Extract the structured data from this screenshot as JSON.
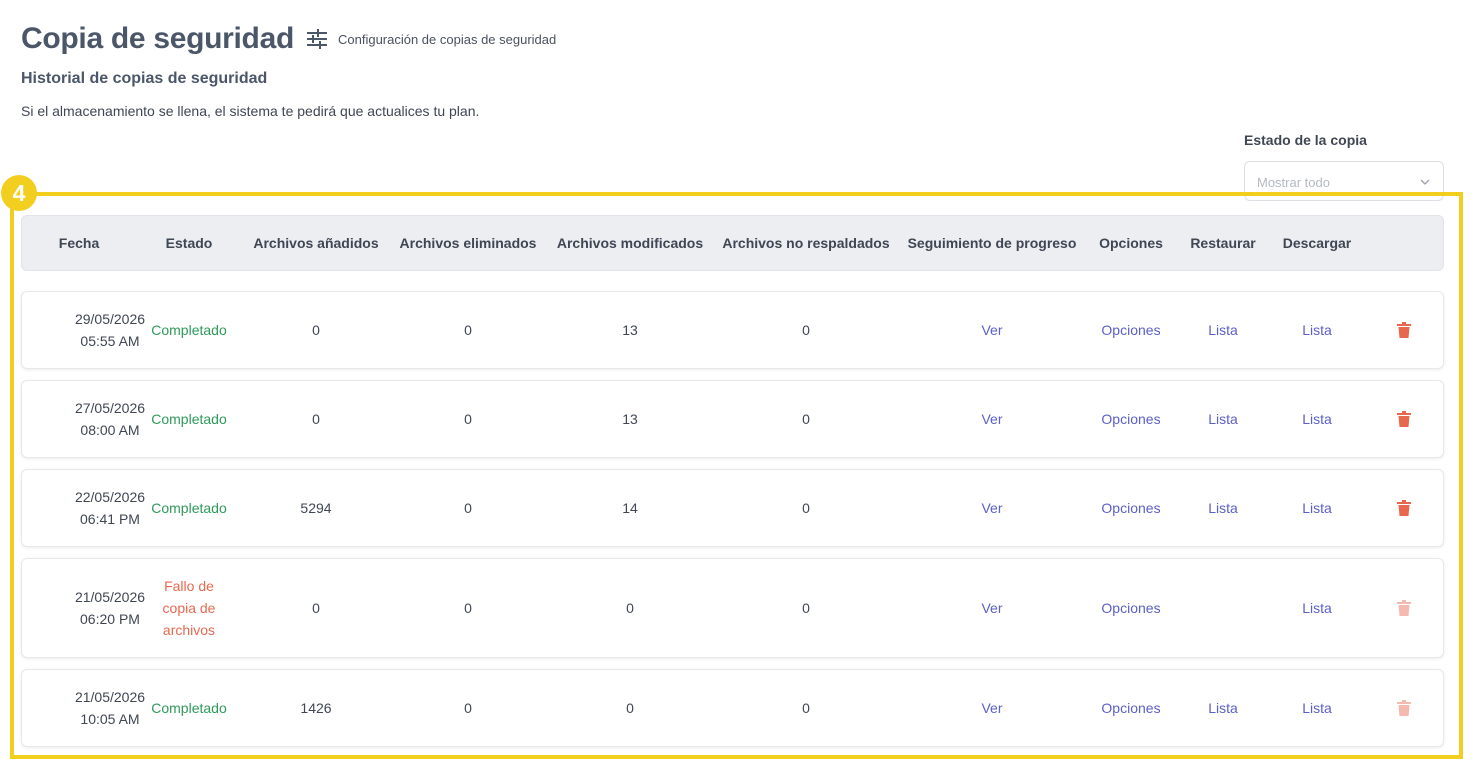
{
  "header": {
    "title": "Copia de seguridad",
    "settings_link": "Configuración de copias de seguridad"
  },
  "history": {
    "title": "Historial de copias de seguridad",
    "description": "Si el almacenamiento se llena, el sistema te pedirá que actualices tu plan."
  },
  "filter": {
    "label": "Estado de la copia",
    "placeholder": "Mostrar todo"
  },
  "annotation": {
    "badge": "4",
    "color": "#f2cf1f"
  },
  "colors": {
    "success": "#2e9a5a",
    "failure": "#e8684f",
    "link": "#5b5fc7",
    "delete": "#e8684f"
  },
  "table": {
    "columns": {
      "fecha": "Fecha",
      "estado": "Estado",
      "anadidos": "Archivos añadidos",
      "eliminados": "Archivos eliminados",
      "modificados": "Archivos modificados",
      "no_respaldados": "Archivos no respaldados",
      "seguimiento": "Seguimiento de progreso",
      "opciones": "Opciones",
      "restaurar": "Restaurar",
      "descargar": "Descargar"
    },
    "rows": [
      {
        "date": "29/05/2026",
        "time": "05:55 AM",
        "status": "Completado",
        "added": "0",
        "deleted": "0",
        "modified": "13",
        "not_backed": "0",
        "progress": "Ver",
        "options": "Opciones",
        "restore": "Lista",
        "download": "Lista"
      },
      {
        "date": "27/05/2026",
        "time": "08:00 AM",
        "status": "Completado",
        "added": "0",
        "deleted": "0",
        "modified": "13",
        "not_backed": "0",
        "progress": "Ver",
        "options": "Opciones",
        "restore": "Lista",
        "download": "Lista"
      },
      {
        "date": "22/05/2026",
        "time": "06:41 PM",
        "status": "Completado",
        "added": "5294",
        "deleted": "0",
        "modified": "14",
        "not_backed": "0",
        "progress": "Ver",
        "options": "Opciones",
        "restore": "Lista",
        "download": "Lista"
      },
      {
        "date": "21/05/2026",
        "time": "06:20 PM",
        "status_line1": "Fallo de",
        "status_line2": "copia de",
        "status_line3": "archivos",
        "added": "0",
        "deleted": "0",
        "modified": "0",
        "not_backed": "0",
        "progress": "Ver",
        "options": "Opciones",
        "download": "Lista"
      },
      {
        "date": "21/05/2026",
        "time": "10:05 AM",
        "status": "Completado",
        "added": "1426",
        "deleted": "0",
        "modified": "0",
        "not_backed": "0",
        "progress": "Ver",
        "options": "Opciones",
        "restore": "Lista",
        "download": "Lista"
      }
    ]
  }
}
